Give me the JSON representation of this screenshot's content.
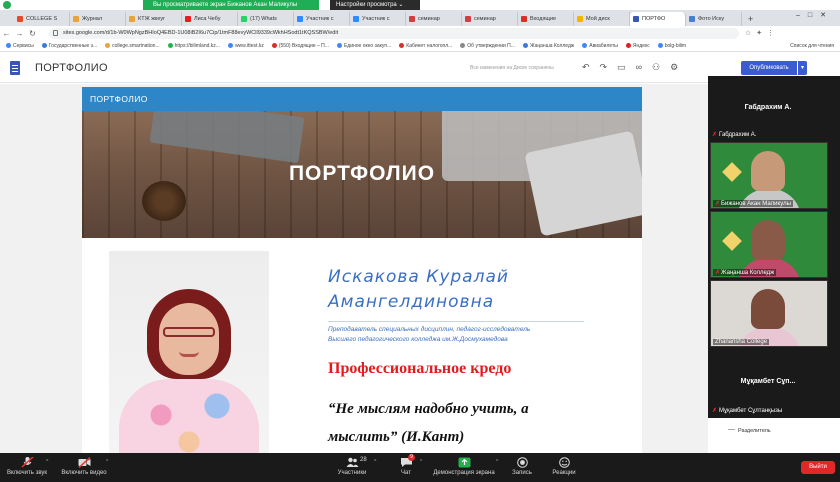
{
  "zoom_share": {
    "viewing_text": "Вы просматриваете экран Бижанов Акан Маликулы",
    "view_settings": "Настройки просмотра ⌄"
  },
  "tabs": [
    {
      "label": "COLLEGE S",
      "color": "#e34b2a"
    },
    {
      "label": "Журнал",
      "color": "#e8a33a"
    },
    {
      "label": "КТЖ жкеуг",
      "color": "#e8a33a"
    },
    {
      "label": "Лиса Чебу",
      "color": "#e02020"
    },
    {
      "label": "(17) Whats",
      "color": "#25d366"
    },
    {
      "label": "Участник с",
      "color": "#2d8cff"
    },
    {
      "label": "Участник с",
      "color": "#2d8cff"
    },
    {
      "label": "семинар",
      "color": "#d04040"
    },
    {
      "label": "семинар",
      "color": "#d04040"
    },
    {
      "label": "Входящие",
      "color": "#d93025"
    },
    {
      "label": "Мой диск",
      "color": "#f4b400"
    },
    {
      "label": "ПОРТФО",
      "color": "#3a56b8"
    },
    {
      "label": "Фото Иску",
      "color": "#4a7ed0"
    }
  ],
  "address": {
    "url": "sites.google.com/d/1b-W0WpNgzBHIoQ4EBD-1U08iB2I6u7Cip/1tmF88evyWCll9339cWkhHSodt1tKQSSBW/edit"
  },
  "bookmarks": [
    {
      "label": "Сервисы",
      "color": "#4285f4"
    },
    {
      "label": "Государственные з...",
      "color": "#3a7bd5"
    },
    {
      "label": "college.smartnation...",
      "color": "#e8a33a"
    },
    {
      "label": "https://bilimland.kz...",
      "color": "#25b34b"
    },
    {
      "label": "www.ittest.kz",
      "color": "#4285f4"
    },
    {
      "label": "(550) Входящие – П...",
      "color": "#d93025"
    },
    {
      "label": "Единое окно закуп...",
      "color": "#4285f4"
    },
    {
      "label": "Кабинет налогопл...",
      "color": "#d93025"
    },
    {
      "label": "Об утверждении П...",
      "color": "#888888"
    },
    {
      "label": "Жаңанша Колледж",
      "color": "#3a7bd5"
    },
    {
      "label": "Авиабилеты",
      "color": "#4285f4"
    },
    {
      "label": "Яндекс",
      "color": "#e02020"
    },
    {
      "label": "bolg-bilim",
      "color": "#4285f4"
    }
  ],
  "bookmarks_right": "Список для чтения",
  "sites": {
    "title": "ПОРТФОЛИО",
    "saved_status": "Все изменения на Диске сохранены",
    "publish_label": "Опубликовать",
    "publish_drop": "▾"
  },
  "page": {
    "nav_title": "ПОРТФОЛИО",
    "hero_title": "ПОРТФОЛИО",
    "name_line1": "Искакова Куралай",
    "name_line2": "Амангелдиновна",
    "subtitle_line1": "Преподаватель специальных дисциплин, педагог-исследователь",
    "subtitle_line2": "Высшего педагогического колледжа им.Ж.Досмухамедова",
    "credo": "Профессиональное кредо",
    "quote_line1": "“Не мыслям надобно учить, а",
    "quote_line2": "мыслить”     (И.Кант)"
  },
  "participants": {
    "top_name": "Габдрахим А.",
    "top_label": "Габдрахим А.",
    "tile1_label": "Бижанов Акан Маликулы",
    "tile2_label": "Жаңанша Колледж",
    "tile3_label": "Zhanansha College",
    "bottom_name": "Мұқамбет Сұп...",
    "bottom_label": "Мұқамбет Сұлтанқызы",
    "college_text": "ZHANSHA COLLEGE",
    "college_text2": "ZHA\nCO"
  },
  "edge_panel": {
    "divider": "Разделитель"
  },
  "zoom_bar": {
    "audio": "Включить звук",
    "video": "Включить видео",
    "participants": "Участники",
    "participants_count": "28",
    "chat": "Чат",
    "chat_badge": "9",
    "share": "Демонстрация экрана",
    "record": "Запись",
    "reactions": "Реакции",
    "end": "Выйти"
  }
}
